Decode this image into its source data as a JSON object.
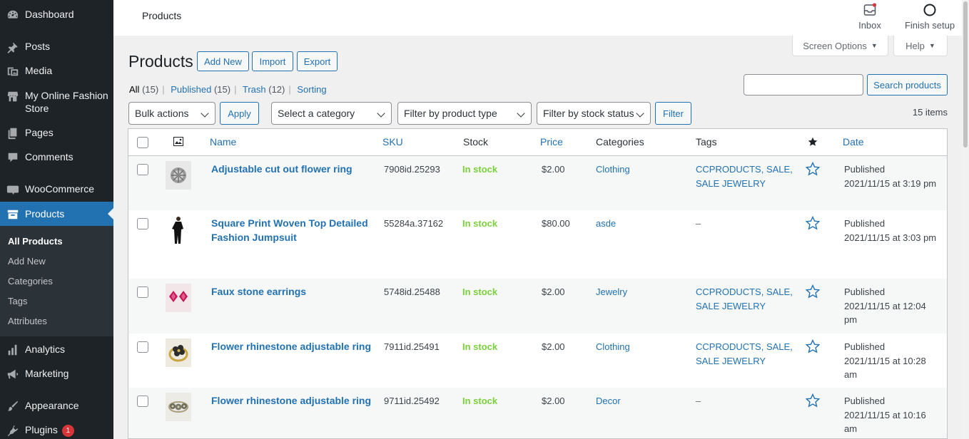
{
  "sidebar": {
    "items": [
      {
        "label": "Dashboard",
        "icon": "dashboard-icon"
      },
      {
        "label": "Posts",
        "icon": "pin-icon"
      },
      {
        "label": "Media",
        "icon": "media-icon"
      },
      {
        "label": "My Online Fashion Store",
        "line1": "My Online Fashion",
        "line2": "Store",
        "icon": "store-icon"
      },
      {
        "label": "Pages",
        "icon": "pages-icon"
      },
      {
        "label": "Comments",
        "icon": "comments-icon"
      },
      {
        "label": "WooCommerce",
        "icon": "woocommerce-icon"
      },
      {
        "label": "Products",
        "icon": "archive-icon"
      },
      {
        "label": "Analytics",
        "icon": "analytics-icon"
      },
      {
        "label": "Marketing",
        "icon": "megaphone-icon"
      },
      {
        "label": "Appearance",
        "icon": "brush-icon"
      },
      {
        "label": "Plugins",
        "icon": "plugin-icon",
        "badge": "1"
      }
    ],
    "submenu": [
      "All Products",
      "Add New",
      "Categories",
      "Tags",
      "Attributes"
    ]
  },
  "topbar": {
    "title": "Products",
    "inbox_label": "Inbox",
    "finish_setup_label": "Finish setup"
  },
  "screen_options_label": "Screen Options",
  "help_label": "Help",
  "page": {
    "heading": "Products",
    "actions": [
      "Add New",
      "Import",
      "Export"
    ]
  },
  "views": [
    {
      "label": "All",
      "count": "(15)",
      "current": true
    },
    {
      "label": "Published",
      "count": "(15)"
    },
    {
      "label": "Trash",
      "count": "(12)"
    },
    {
      "label": "Sorting",
      "count": ""
    }
  ],
  "search": {
    "button": "Search products",
    "value": ""
  },
  "filters": {
    "bulk_actions": "Bulk actions",
    "apply": "Apply",
    "category": "Select a category",
    "product_type": "Filter by product type",
    "stock_status": "Filter by stock status",
    "filter": "Filter",
    "items_count": "15 items"
  },
  "table": {
    "headers": {
      "name": "Name",
      "sku": "SKU",
      "stock": "Stock",
      "price": "Price",
      "categories": "Categories",
      "tags": "Tags",
      "date": "Date"
    },
    "rows": [
      {
        "name": "Adjustable cut out flower ring",
        "name2": "",
        "sku": "7908id.25293",
        "stock": "In stock",
        "price": "$2.00",
        "category": "Clothing",
        "tags1": "CCPRODUCTS, SALE,",
        "tags2": "SALE JEWELRY",
        "date1": "Published",
        "date2": "2021/11/15 at 3:19 pm",
        "date3": "",
        "thumb": "silver-flower-ring"
      },
      {
        "name": "Square Print Woven Top Detailed",
        "name2": "Fashion Jumpsuit",
        "sku": "55284a.37162",
        "stock": "In stock",
        "price": "$80.00",
        "category": "asde",
        "tags1": "–",
        "tags2": "",
        "date1": "Published",
        "date2": "2021/11/15 at 3:03 pm",
        "date3": "",
        "thumb": "black-jumpsuit"
      },
      {
        "name": "Faux stone earrings",
        "name2": "",
        "sku": "5748id.25488",
        "stock": "In stock",
        "price": "$2.00",
        "category": "Jewelry",
        "tags1": "CCPRODUCTS, SALE,",
        "tags2": "SALE JEWELRY",
        "date1": "Published",
        "date2": "2021/11/15 at 12:04",
        "date3": "pm",
        "thumb": "pink-earrings"
      },
      {
        "name": "Flower rhinestone adjustable ring",
        "name2": "",
        "sku": "7911id.25491",
        "stock": "In stock",
        "price": "$2.00",
        "category": "Clothing",
        "tags1": "CCPRODUCTS, SALE,",
        "tags2": "SALE JEWELRY",
        "date1": "Published",
        "date2": "2021/11/15 at 10:28",
        "date3": "am",
        "thumb": "gold-flower-ring"
      },
      {
        "name": "Flower rhinestone adjustable ring",
        "name2": "",
        "sku": "9711id.25492",
        "stock": "In stock",
        "price": "$2.00",
        "category": "Decor",
        "tags1": "–",
        "tags2": "",
        "date1": "Published",
        "date2": "2021/11/15 at 10:16",
        "date3": "am",
        "thumb": "silver-rhinestone-ring"
      }
    ]
  },
  "colors": {
    "sidebar_bg": "#1d2327",
    "accent": "#2271b1",
    "in_stock": "#7ad03a",
    "badge": "#d63638"
  }
}
